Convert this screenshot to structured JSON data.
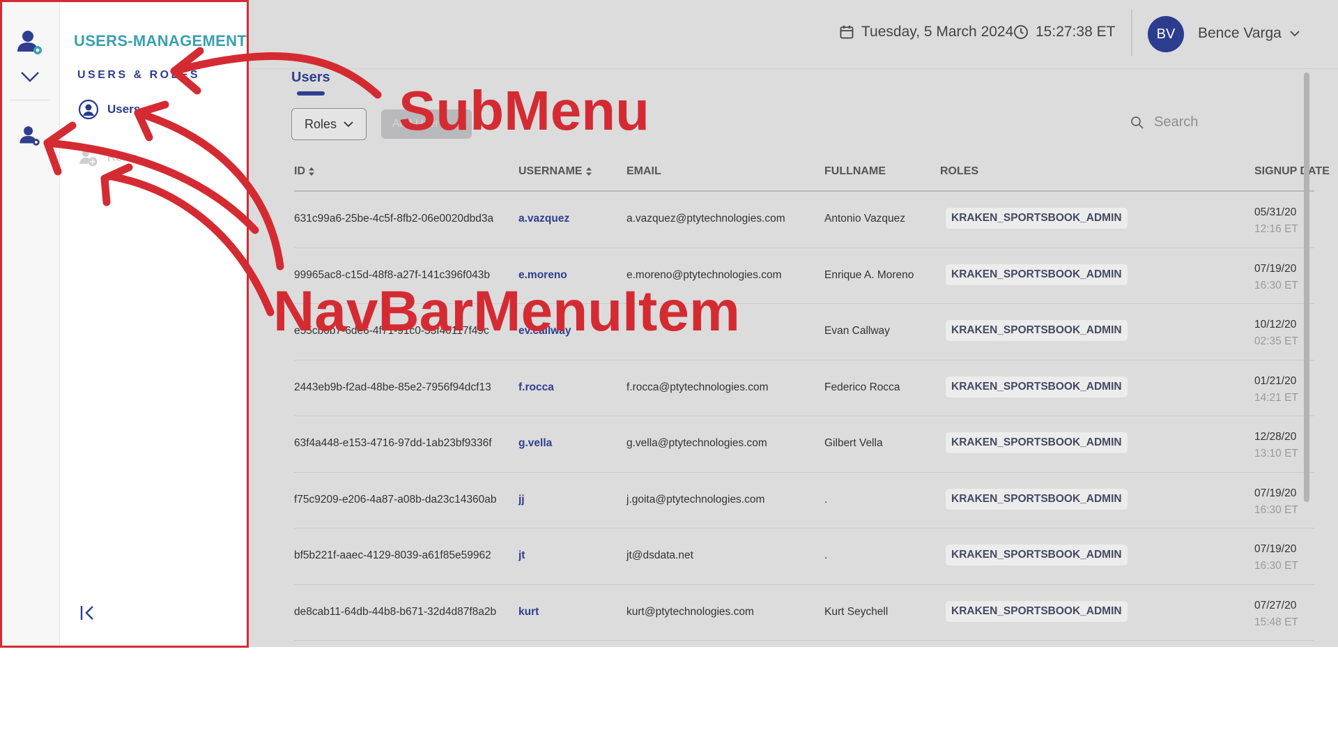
{
  "sidebar": {
    "module_title": "USERS-MANAGEMENT",
    "section_title": "USERS & ROLES",
    "items": [
      {
        "label": "Users",
        "icon": "user-circle-icon",
        "state": "active"
      },
      {
        "label": "Roles",
        "icon": "user-add-icon",
        "state": "disabled"
      }
    ]
  },
  "header": {
    "date": "Tuesday, 5 March 2024",
    "time": "15:27:38 ET",
    "user": {
      "initials": "BV",
      "name": "Bence Varga"
    }
  },
  "content": {
    "tab": "Users",
    "roles_filter_label": "Roles",
    "add_button_label": "Add User",
    "search_placeholder": "Search"
  },
  "table": {
    "headers": {
      "id": "ID",
      "username": "USERNAME",
      "email": "EMAIL",
      "fullname": "FULLNAME",
      "roles": "ROLES",
      "signup": "SIGNUP DATE"
    },
    "rows": [
      {
        "id": "631c99a6-25be-4c5f-8fb2-06e0020dbd3a",
        "username": "a.vazquez",
        "email": "a.vazquez@ptytechnologies.com",
        "fullname": "Antonio Vazquez",
        "role": "KRAKEN_SPORTSBOOK_ADMIN",
        "signup_date": "05/31/20",
        "signup_time": "12:16 ET"
      },
      {
        "id": "99965ac8-c15d-48f8-a27f-141c396f043b",
        "username": "e.moreno",
        "email": "e.moreno@ptytechnologies.com",
        "fullname": "Enrique A. Moreno",
        "role": "KRAKEN_SPORTSBOOK_ADMIN",
        "signup_date": "07/19/20",
        "signup_time": "16:30 ET"
      },
      {
        "id": "e55cb0b7-6de6-4f71-91c0-53f40117f49c",
        "username": "ev.callway",
        "email": "",
        "fullname": "Evan Callway",
        "role": "KRAKEN_SPORTSBOOK_ADMIN",
        "signup_date": "10/12/20",
        "signup_time": "02:35 ET"
      },
      {
        "id": "2443eb9b-f2ad-48be-85e2-7956f94dcf13",
        "username": "f.rocca",
        "email": "f.rocca@ptytechnologies.com",
        "fullname": "Federico Rocca",
        "role": "KRAKEN_SPORTSBOOK_ADMIN",
        "signup_date": "01/21/20",
        "signup_time": "14:21 ET"
      },
      {
        "id": "63f4a448-e153-4716-97dd-1ab23bf9336f",
        "username": "g.vella",
        "email": "g.vella@ptytechnologies.com",
        "fullname": "Gilbert Vella",
        "role": "KRAKEN_SPORTSBOOK_ADMIN",
        "signup_date": "12/28/20",
        "signup_time": "13:10 ET"
      },
      {
        "id": "f75c9209-e206-4a87-a08b-da23c14360ab",
        "username": "jj",
        "email": "j.goita@ptytechnologies.com",
        "fullname": ".",
        "role": "KRAKEN_SPORTSBOOK_ADMIN",
        "signup_date": "07/19/20",
        "signup_time": "16:30 ET"
      },
      {
        "id": "bf5b221f-aaec-4129-8039-a61f85e59962",
        "username": "jt",
        "email": "jt@dsdata.net",
        "fullname": ".",
        "role": "KRAKEN_SPORTSBOOK_ADMIN",
        "signup_date": "07/19/20",
        "signup_time": "16:30 ET"
      },
      {
        "id": "de8cab11-64db-44b8-b671-32d4d87f8a2b",
        "username": "kurt",
        "email": "kurt@ptytechnologies.com",
        "fullname": "Kurt Seychell",
        "role": "KRAKEN_SPORTSBOOK_ADMIN",
        "signup_date": "07/27/20",
        "signup_time": "15:48 ET"
      }
    ]
  },
  "annotations": {
    "submenu_label": "SubMenu",
    "navbar_label": "NavBarMenuItem",
    "color": "#d42b33"
  },
  "theme": {
    "accent": "#2f3e8f",
    "module_title_color": "#3aa0b0",
    "avatar_bg": "#2c3d8f"
  }
}
